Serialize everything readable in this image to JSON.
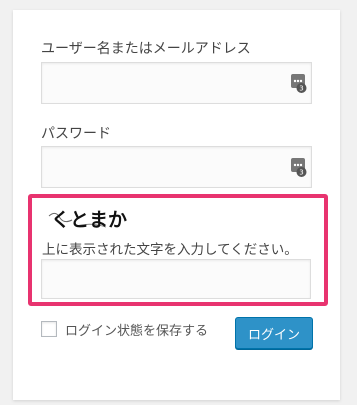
{
  "login_form": {
    "username_label": "ユーザー名またはメールアドレス",
    "password_label": "パスワード",
    "username_value": "",
    "password_value": "",
    "password_manager_icon": "password-manager-icon",
    "password_manager_badge": "3"
  },
  "captcha": {
    "image_text": "くとまか",
    "instruction": "上に表示された文字を入力してください。",
    "input_value": "",
    "highlight_color": "#e8336f"
  },
  "remember_me": {
    "label": "ログイン状態を保存する",
    "checked": false
  },
  "submit": {
    "label": "ログイン",
    "color": "#2e92c8"
  }
}
